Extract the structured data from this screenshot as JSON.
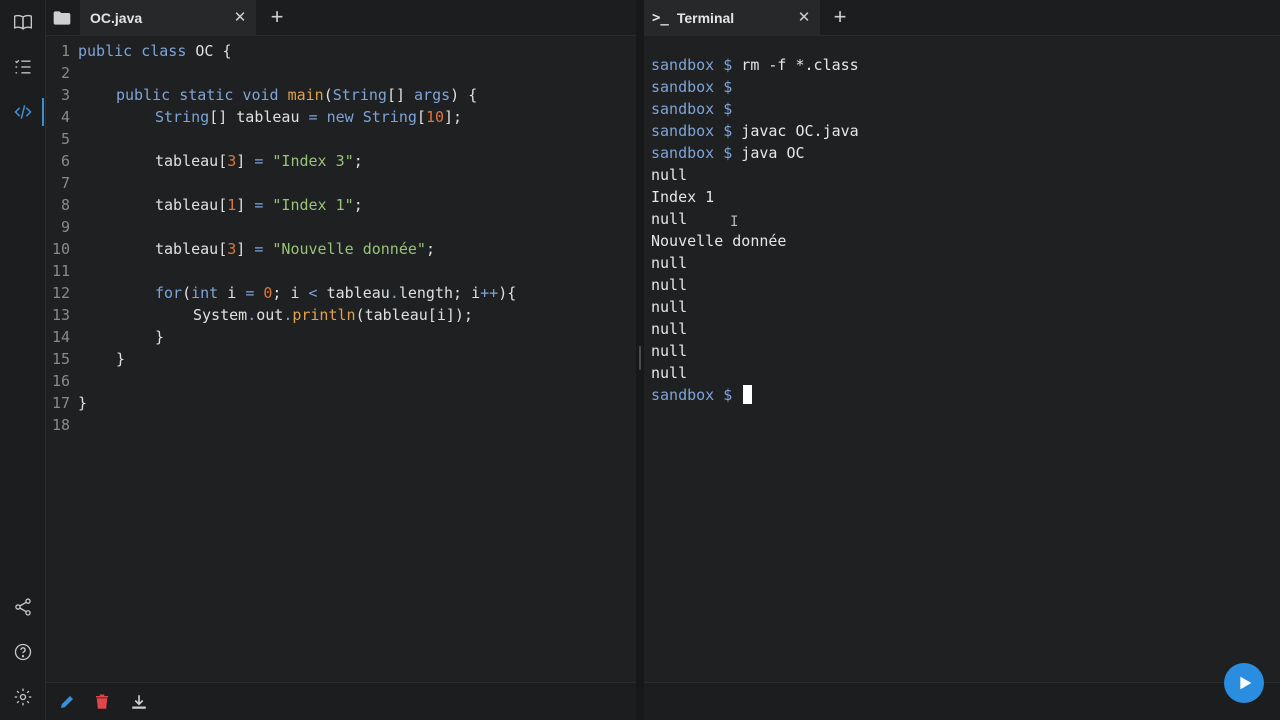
{
  "activity_bar": {
    "items": [
      {
        "name": "book-icon"
      },
      {
        "name": "checklist-icon"
      },
      {
        "name": "code-icon",
        "active": true
      }
    ],
    "bottom": [
      {
        "name": "share-icon"
      },
      {
        "name": "help-icon"
      },
      {
        "name": "gear-icon"
      }
    ]
  },
  "editor": {
    "tab_label": "OC.java",
    "line_numbers": [
      "1",
      "2",
      "3",
      "4",
      "5",
      "6",
      "7",
      "8",
      "9",
      "10",
      "11",
      "12",
      "13",
      "14",
      "15",
      "16",
      "17",
      "18"
    ],
    "code": {
      "l1": {
        "a": "public",
        "b": " ",
        "c": "class",
        "d": " OC {"
      },
      "l3": {
        "a": "public",
        "b": "static",
        "c": "void",
        "d": "main",
        "e": "String",
        "f": "[] ",
        "g": "args",
        "h": ") {"
      },
      "l4": {
        "a": "String",
        "b": "[] tableau ",
        "c": "=",
        "d": "new",
        "e": "String",
        "f": "[",
        "g": "10",
        "h": "];"
      },
      "l6": {
        "a": "tableau[",
        "b": "3",
        "c": "] ",
        "d": "=",
        "e": "\"Index 3\"",
        "f": ";"
      },
      "l8": {
        "a": "tableau[",
        "b": "1",
        "c": "] ",
        "d": "=",
        "e": "\"Index 1\"",
        "f": ";"
      },
      "l10": {
        "a": "tableau[",
        "b": "3",
        "c": "] ",
        "d": "=",
        "e": "\"Nouvelle donnée\"",
        "f": ";"
      },
      "l12": {
        "a": "for",
        "b": "(",
        "c": "int",
        "d": " i ",
        "e": "=",
        "f": "0",
        "g": "; i ",
        "h": "<",
        "i": " tableau",
        "j": ".",
        "k": "length; i",
        "l": "++",
        "m": "){"
      },
      "l13": {
        "a": "System",
        "b": ".",
        "c": "out",
        "d": ".",
        "e": "println",
        "f": "(tableau[i]);"
      },
      "l14": "}",
      "l15": "}",
      "l17": "}"
    }
  },
  "terminal": {
    "tab_label": "Terminal",
    "tab_icon": ">_",
    "lines": [
      {
        "prompt": "sandbox $",
        "cmd": " rm -f *.class"
      },
      {
        "prompt": "sandbox $",
        "cmd": ""
      },
      {
        "prompt": "sandbox $",
        "cmd": ""
      },
      {
        "prompt": "sandbox $",
        "cmd": " javac OC.java"
      },
      {
        "prompt": "sandbox $",
        "cmd": " java OC"
      }
    ],
    "output": [
      "null",
      "Index 1",
      "null",
      "Nouvelle donnée",
      "null",
      "null",
      "null",
      "null",
      "null",
      "null"
    ],
    "final_prompt": "sandbox $"
  },
  "footer_icons": [
    "pencil-icon",
    "trash-icon",
    "download-icon"
  ],
  "run_button": {
    "icon": "play-icon"
  },
  "colors": {
    "accent": "#2b8de0",
    "keyword": "#7ea4d8",
    "function": "#e2a14a",
    "number": "#e0763c",
    "string": "#98c379"
  }
}
